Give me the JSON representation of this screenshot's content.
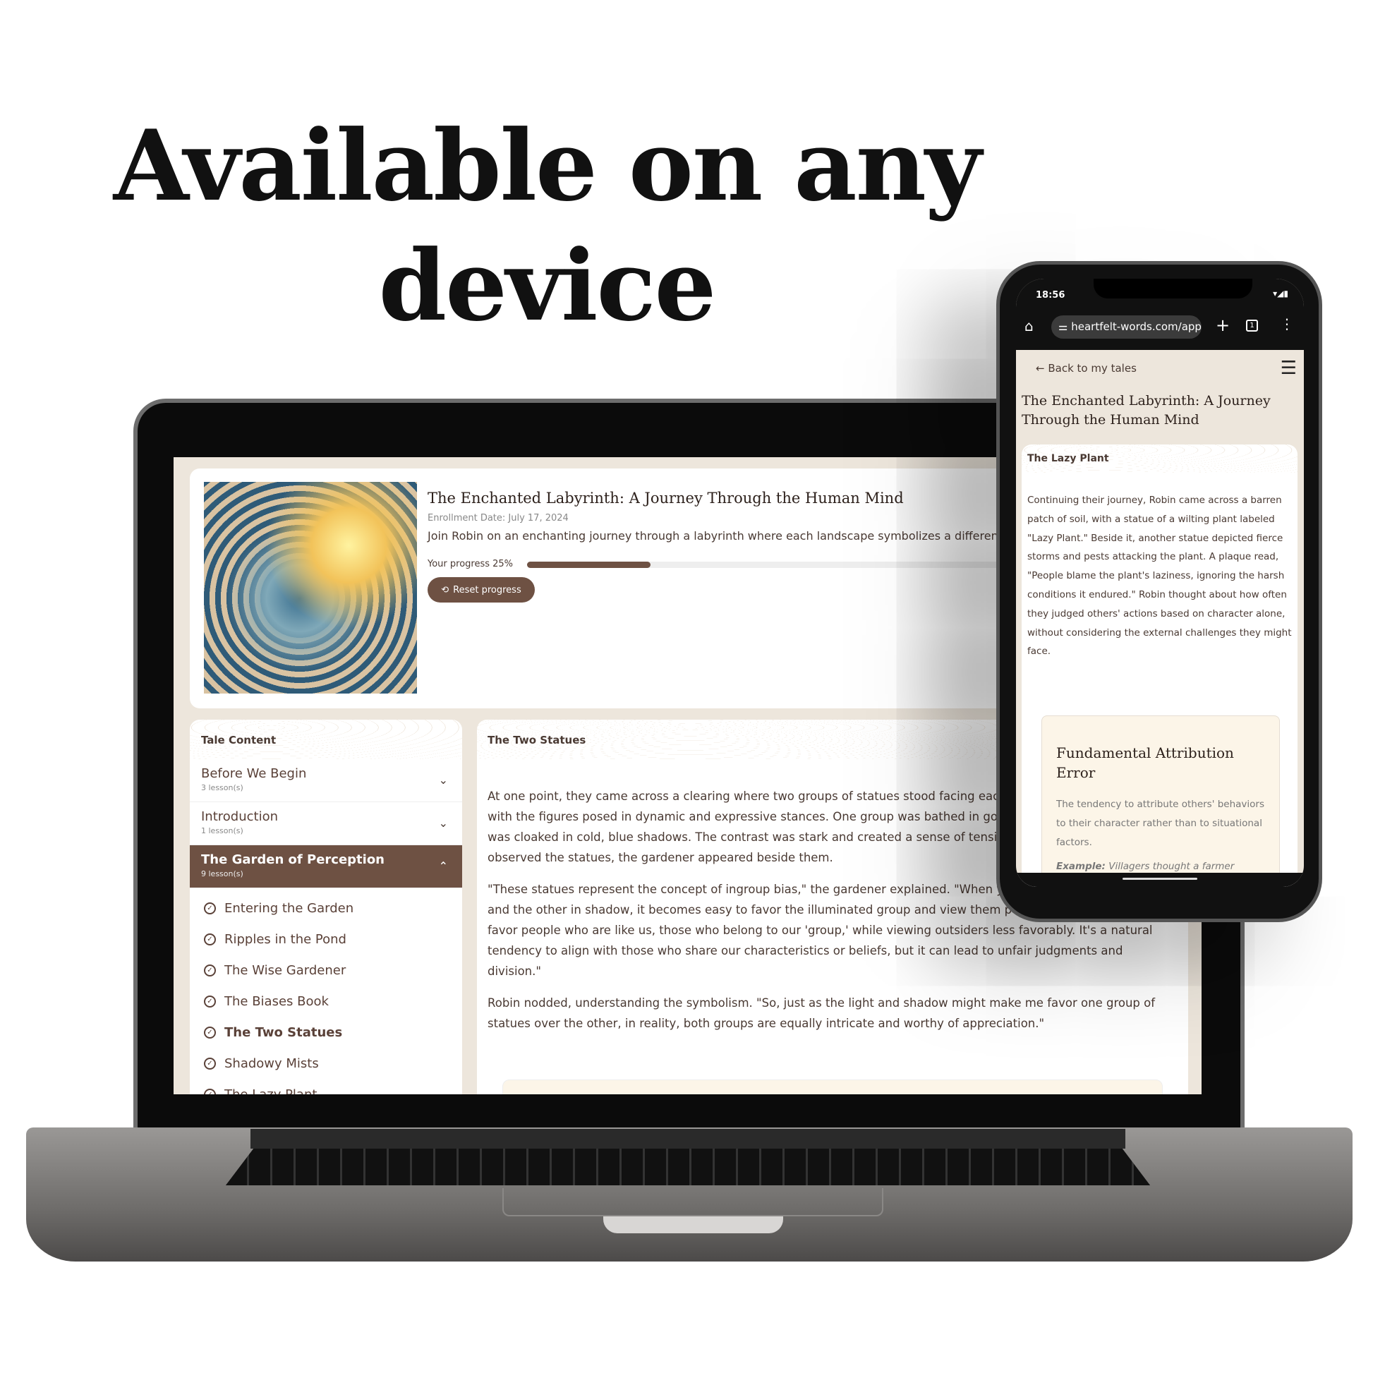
{
  "headline": {
    "line1": "Available on any",
    "line2": "device"
  },
  "laptop": {
    "course": {
      "title": "The Enchanted Labyrinth: A Journey Through the Human Mind",
      "enrollment": "Enrollment Date: July 17, 2024",
      "description": "Join Robin on an enchanting journey through a labyrinth where each landscape symbolizes a different",
      "progress_label": "Your progress 25%",
      "progress_percent": 25,
      "reset_label": "Reset progress"
    },
    "sidebar": {
      "title": "Tale Content",
      "modules": [
        {
          "title": "Before We Begin",
          "count": "3 lesson(s)",
          "expanded": false
        },
        {
          "title": "Introduction",
          "count": "1 lesson(s)",
          "expanded": false
        },
        {
          "title": "The Garden of Perception",
          "count": "9 lesson(s)",
          "expanded": true
        }
      ],
      "lessons": [
        "Entering the Garden",
        "Ripples in the Pond",
        "The Wise Gardener",
        "The Biases Book",
        "The Two Statues",
        "Shadowy Mists",
        "The Lazy Plant"
      ],
      "current_lesson": "The Two Statues"
    },
    "lesson": {
      "title": "The Two Statues",
      "paragraphs": [
        "At one point, they came across a clearing where two groups of statues stood facing each other, intricately carved, with the figures posed in dynamic and expressive stances. One group was bathed in golden light, while the other was cloaked in cold, blue shadows. The contrast was stark and created a sense of tension in the air. As they observed the statues, the gardener appeared beside them.",
        "\"These statues represent the concept of ingroup bias,\" the gardener explained. \"When you see one group in light and the other in shadow, it becomes easy to favor the illuminated group and view them positively. We innately favor people who are like us, those who belong to our 'group,' while viewing outsiders less favorably. It's a natural tendency to align with those who share our characteristics or beliefs, but it can lead to unfair judgments and division.\"",
        "Robin nodded, understanding the symbolism. \"So, just as the light and shadow might make me favor one group of statues over the other, in reality, both groups are equally intricate and worthy of appreciation.\""
      ]
    }
  },
  "phone": {
    "time": "18:56",
    "url": "heartfelt-words.com/app",
    "tab_count": "1",
    "back_label": "Back to my tales",
    "course_title": "The Enchanted Labyrinth: A Journey Through the Human Mind",
    "lesson_title": "The Lazy Plant",
    "paragraph": "Continuing their journey, Robin came across a barren patch of soil, with a statue of a wilting plant labeled \"Lazy Plant.\" Beside it, another statue depicted fierce storms and pests attacking the plant. A plaque read, \"People blame the plant's laziness, ignoring the harsh conditions it endured.\" Robin thought about how often they judged others' actions based on character alone, without considering the external challenges they might face.",
    "callout": {
      "title": "Fundamental Attribution Error",
      "definition": "The tendency to attribute others' behaviors to their character rather than to situational factors.",
      "example_label": "Example:",
      "example_text": "Villagers thought a farmer"
    }
  },
  "colors": {
    "accent": "#6e5143",
    "background": "#ede6dc",
    "callout": "#fcf5e8"
  }
}
